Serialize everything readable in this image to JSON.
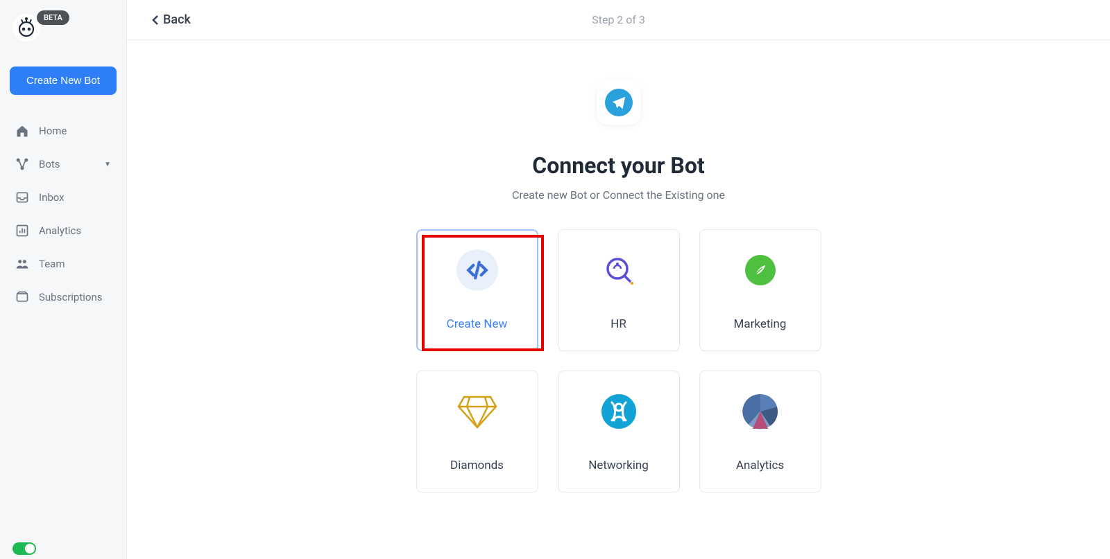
{
  "sidebar": {
    "badge": "BETA",
    "create_bot": "Create New Bot",
    "items": [
      {
        "label": "Home"
      },
      {
        "label": "Bots"
      },
      {
        "label": "Inbox"
      },
      {
        "label": "Analytics"
      },
      {
        "label": "Team"
      },
      {
        "label": "Subscriptions"
      }
    ]
  },
  "header": {
    "back": "Back",
    "step": "Step 2 of 3"
  },
  "main": {
    "title": "Connect your Bot",
    "subtitle": "Create new Bot or Connect the Existing one",
    "cards": [
      {
        "label": "Create New"
      },
      {
        "label": "HR"
      },
      {
        "label": "Marketing"
      },
      {
        "label": "Diamonds"
      },
      {
        "label": "Networking"
      },
      {
        "label": "Analytics"
      }
    ]
  }
}
